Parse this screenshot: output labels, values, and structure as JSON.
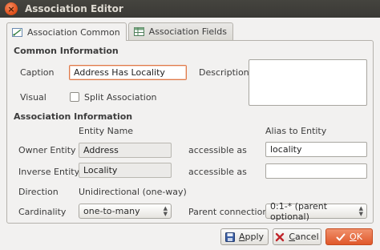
{
  "window": {
    "title": "Association Editor"
  },
  "tabs": [
    {
      "label": "Association Common",
      "active": true,
      "icon": "association-icon"
    },
    {
      "label": "Association Fields",
      "active": false,
      "icon": "table-icon"
    }
  ],
  "common": {
    "heading": "Common Information",
    "caption_label": "Caption",
    "caption_value": "Address Has Locality",
    "description_label": "Description",
    "description_value": "",
    "visual_label": "Visual",
    "split_label": "Split Association",
    "split_checked": false
  },
  "assoc": {
    "heading": "Association Information",
    "entity_name_header": "Entity Name",
    "alias_header": "Alias to Entity",
    "owner_label": "Owner Entity",
    "owner_value": "Address",
    "owner_accessible": "accessible as",
    "owner_alias": "locality",
    "inverse_label": "Inverse Entity",
    "inverse_value": "Locality",
    "inverse_accessible": "accessible as",
    "inverse_alias": "",
    "direction_label": "Direction",
    "direction_value": "Unidirectional (one-way)",
    "cardinality_label": "Cardinality",
    "cardinality_value": "one-to-many",
    "parent_label": "Parent connection",
    "parent_value": "0:1-* (parent optional)"
  },
  "buttons": {
    "apply": {
      "mnemonic": "A",
      "rest": "pply"
    },
    "cancel": {
      "mnemonic": "C",
      "rest": "ancel"
    },
    "ok": {
      "mnemonic": "O",
      "rest": "K"
    }
  },
  "colors": {
    "accent": "#e0582a",
    "titlebar": "#3c3b37",
    "background": "#f2f1f0"
  }
}
